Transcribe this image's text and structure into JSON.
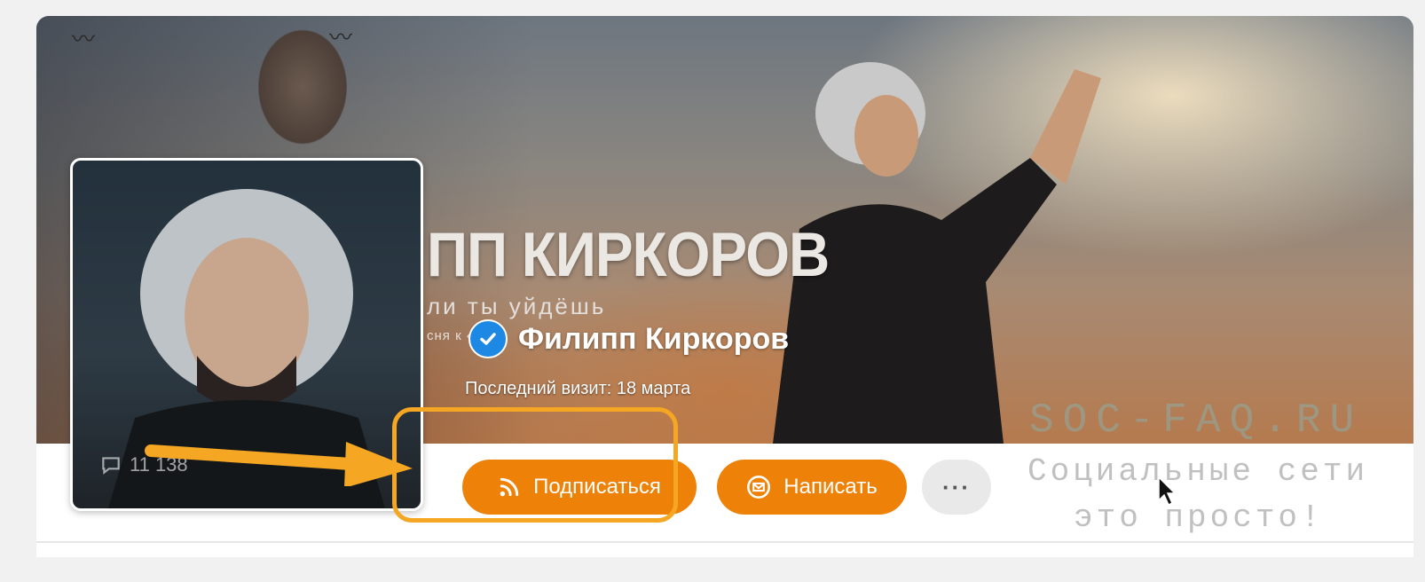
{
  "cover": {
    "title": "ПП КИРКОРОВ",
    "subtitle": "ли ты уйдёшь",
    "small_text": "сня к «..."
  },
  "profile": {
    "name": "Филипп Киркоров",
    "last_visit": "Последний визит: 18 марта",
    "comments_count": "11 138"
  },
  "actions": {
    "subscribe_label": "Подписаться",
    "message_label": "Написать",
    "more_label": "···"
  },
  "watermark": {
    "domain": "SOC-FAQ.RU",
    "line1": "Социальные сети",
    "line2": "это просто!"
  },
  "colors": {
    "accent": "#ee8208",
    "highlight": "#f5a623",
    "verified": "#1e88e5"
  }
}
